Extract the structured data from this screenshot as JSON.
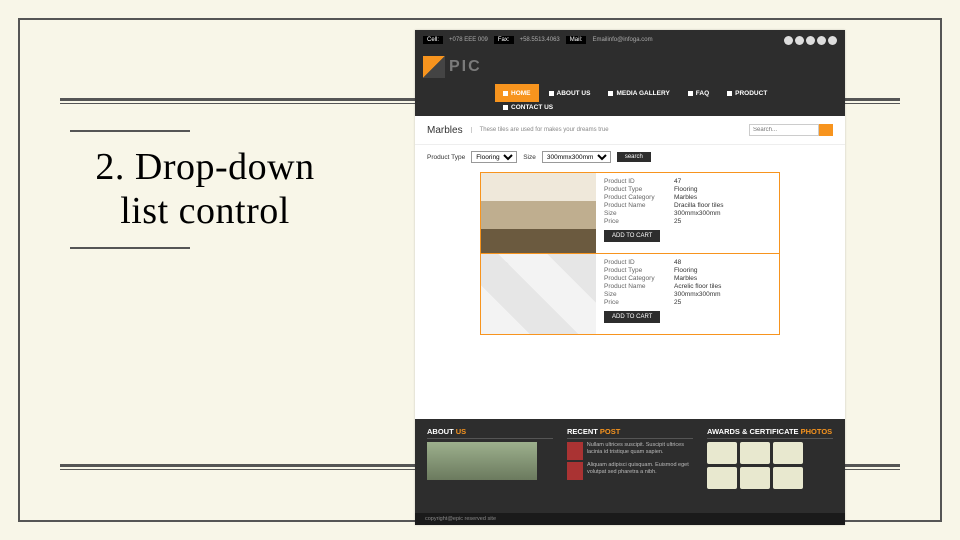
{
  "slide": {
    "title": "2. Drop-down list control"
  },
  "topbar": {
    "cell_label": "Cell:",
    "cell_value": "+078 EEE 009",
    "fax_label": "Fax:",
    "fax_value": "+58.5513.4063",
    "mail_label": "Mail:",
    "mail_value": "Emailinfo@infoga.com"
  },
  "logo": {
    "text": "PIC"
  },
  "nav": {
    "home": "HOME",
    "about": "ABOUT US",
    "media": "MEDIA GALLERY",
    "faq": "FAQ",
    "product": "PRODUCT",
    "contact": "CONTACT US"
  },
  "page": {
    "heading": "Marbles",
    "tagline": "These tiles are used for makes your dreams true",
    "search_placeholder": "Search..."
  },
  "filters": {
    "type_label": "Product Type",
    "type_value": "Flooring",
    "size_label": "Size",
    "size_value": "300mmx300mm",
    "button": "search"
  },
  "products": [
    {
      "fields": {
        "Product ID": "47",
        "Product Type": "Flooring",
        "Product Category": "Marbles",
        "Product Name": "Dracilla floor tiles",
        "Size": "300mmx300mm",
        "Price": "25"
      },
      "cart": "ADD TO CART"
    },
    {
      "fields": {
        "Product ID": "48",
        "Product Type": "Flooring",
        "Product Category": "Marbles",
        "Product Name": "Acrelic floor tiles",
        "Size": "300mmx300mm",
        "Price": "25"
      },
      "cart": "ADD TO CART"
    }
  ],
  "footer": {
    "about_h1": "ABOUT ",
    "about_h2": "US",
    "recent_h1": "RECENT ",
    "recent_h2": "POST",
    "awards_h1": "AWARDS & CERTIFICATE ",
    "awards_h2": "PHOTOS",
    "rp1": "Nullam ultrices suscipit. Suscipit ultrices lacinia id tristique quam sapien.",
    "rp2": "Aliquam adipisci quisquam. Euismod eget volutpat sed pharetra a nibh.",
    "copyright": "copyright@epic reserved site"
  }
}
